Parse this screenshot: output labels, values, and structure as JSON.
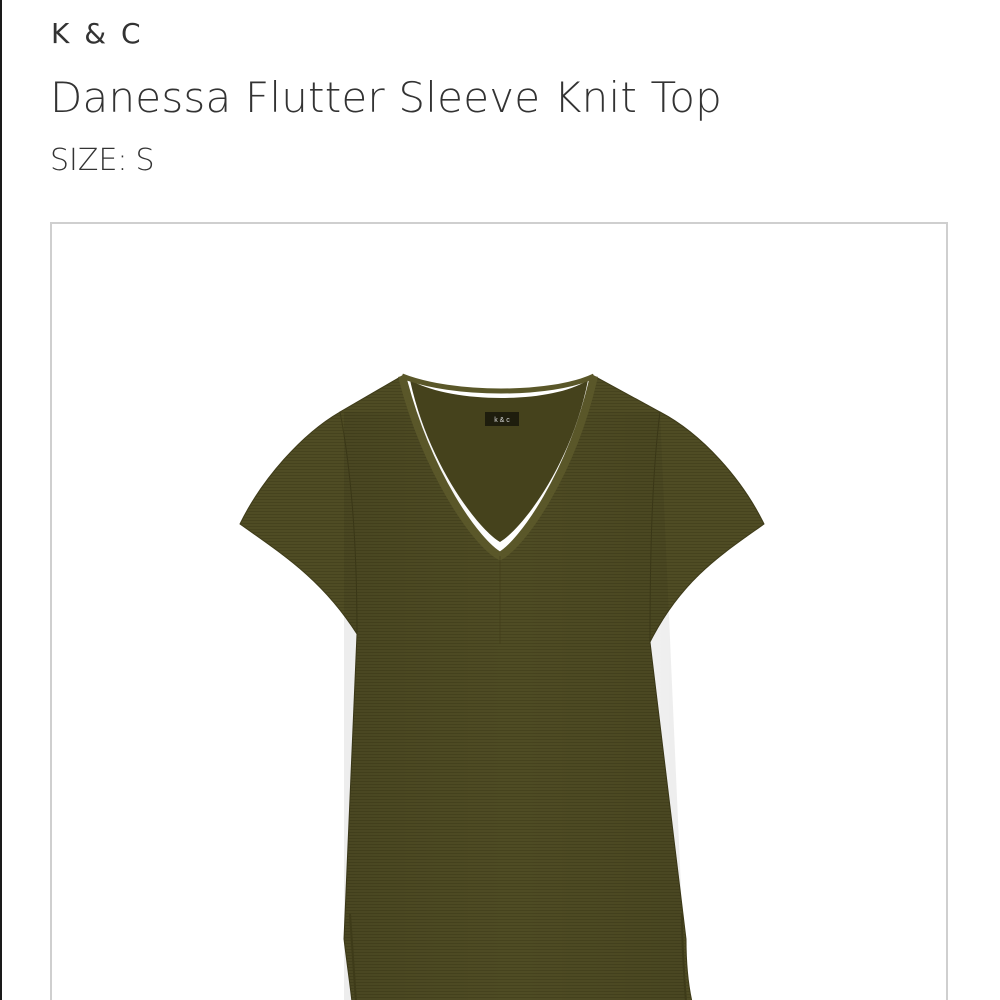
{
  "product": {
    "brand": "K & C",
    "name": "Danessa Flutter Sleeve Knit Top",
    "size_label": "SIZE:",
    "size_value": "S"
  },
  "image": {
    "subject": "shirt-icon",
    "garment_color": "#4d4a22",
    "tag_text": "k & c"
  },
  "colors": {
    "text": "#333333",
    "frame_border": "#cfcfcf",
    "background": "#ffffff"
  }
}
